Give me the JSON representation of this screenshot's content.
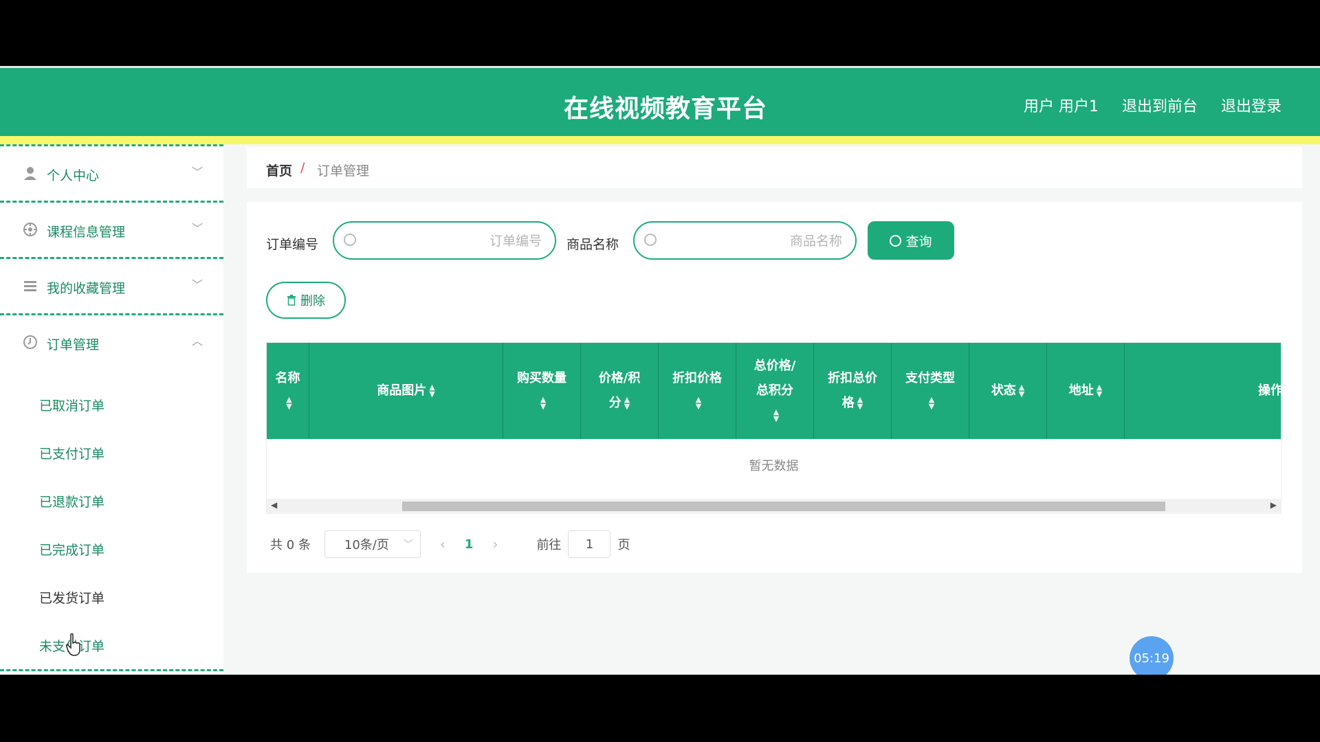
{
  "header": {
    "title": "在线视频教育平台",
    "nav": [
      "用户 用户1",
      "退出到前台",
      "退出登录"
    ]
  },
  "sidebar": {
    "menus": [
      {
        "label": "个人中心",
        "icon": "user-icon",
        "expanded": false
      },
      {
        "label": "课程信息管理",
        "icon": "compass-icon",
        "expanded": false
      },
      {
        "label": "我的收藏管理",
        "icon": "list-icon",
        "expanded": false
      },
      {
        "label": "订单管理",
        "icon": "clock-icon",
        "expanded": true
      }
    ],
    "submenu": [
      "已取消订单",
      "已支付订单",
      "已退款订单",
      "已完成订单",
      "已发货订单",
      "未支付订单"
    ]
  },
  "breadcrumb": {
    "home": "首页",
    "separator": "/",
    "current": "订单管理"
  },
  "search": {
    "order_no_label": "订单编号",
    "order_no_placeholder": "订单编号",
    "product_label": "商品名称",
    "product_placeholder": "商品名称",
    "query_label": "查询"
  },
  "actions": {
    "delete_label": "删除"
  },
  "table": {
    "columns": [
      "名称",
      "商品图片",
      "购买数量",
      "价格/积分",
      "折扣价格",
      "总价格/总积分",
      "折扣总价格",
      "支付类型",
      "状态",
      "地址",
      "操作"
    ],
    "empty_text": "暂无数据"
  },
  "pagination": {
    "total": "共 0 条",
    "page_size": "10条/页",
    "current_page": "1",
    "goto_label": "前往",
    "goto_value": "1",
    "page_suffix": "页"
  },
  "timer": "05:19",
  "colors": {
    "primary": "#1dab7b",
    "accent_bar": "#f7f76a",
    "timer": "#5aa3f0"
  }
}
